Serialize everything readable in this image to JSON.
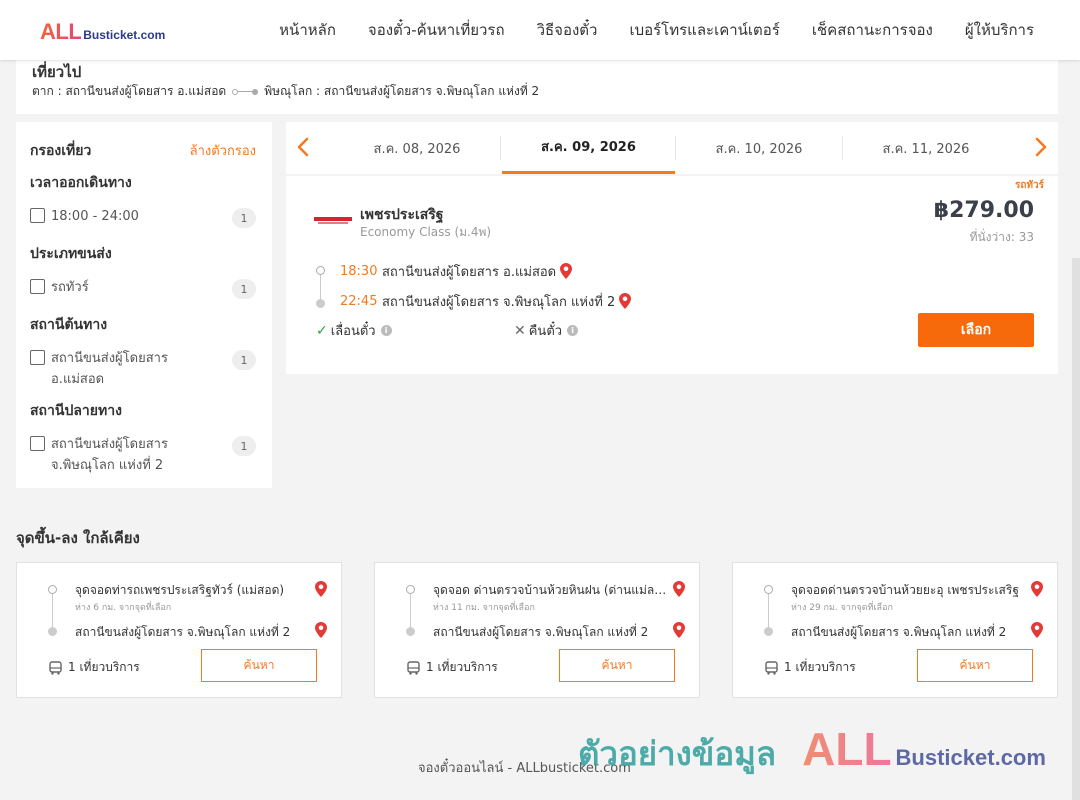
{
  "logo": {
    "all": "ALL",
    "rest": "Busticket.com"
  },
  "nav": [
    "หน้าหลัก",
    "จองตั๋ว-ค้นหาเที่ยวรถ",
    "วิธีจองตั๋ว",
    "เบอร์โทรและเคาน์เตอร์",
    "เช็คสถานะการจอง",
    "ผู้ให้บริการ"
  ],
  "trip": {
    "title": "เที่ยวไป",
    "from": "ตาก : สถานีขนส่งผู้โดยสาร อ.แม่สอด",
    "to": "พิษณุโลก : สถานีขนส่งผู้โดยสาร จ.พิษณุโลก แห่งที่ 2"
  },
  "filters": {
    "title": "กรองเที่ยว",
    "clear": "ล้างตัวกรอง",
    "sections": [
      {
        "title": "เวลาออกเดินทาง",
        "options": [
          {
            "label": "18:00 - 24:00",
            "count": "1"
          }
        ]
      },
      {
        "title": "ประเภทขนส่ง",
        "options": [
          {
            "label": "รถทัวร์",
            "count": "1"
          }
        ]
      },
      {
        "title": "สถานีต้นทาง",
        "options": [
          {
            "label": "สถานีขนส่งผู้โดยสาร อ.แม่สอด",
            "count": "1"
          }
        ]
      },
      {
        "title": "สถานีปลายทาง",
        "options": [
          {
            "label": "สถานีขนส่งผู้โดยสาร จ.พิษณุโลก แห่งที่ 2",
            "count": "1"
          }
        ]
      }
    ]
  },
  "dates": {
    "tabs": [
      "ส.ค. 08, 2026",
      "ส.ค. 09, 2026",
      "ส.ค. 10, 2026",
      "ส.ค. 11, 2026"
    ],
    "active": 1
  },
  "result": {
    "type_tag": "รถทัวร์",
    "operator": "เพชรประเสริฐ",
    "class": "Economy Class (ม.4พ)",
    "price": "฿279.00",
    "seats": "ที่นั่งว่าง: 33",
    "dep_time": "18:30",
    "dep_place": "สถานีขนส่งผู้โดยสาร อ.แม่สอด",
    "arr_time": "22:45",
    "arr_place": "สถานีขนส่งผู้โดยสาร จ.พิษณุโลก แห่งที่ 2",
    "reschedule": "เลื่อนตั๋ว",
    "refund": "คืนตั๋ว",
    "select": "เลือก"
  },
  "nearby": {
    "title": "จุดขึ้น-ลง ใกล้เคียง",
    "cards": [
      {
        "from": "จุดจอดท่ารถเพชรประเสริฐทัวร์ (แม่สอด)",
        "dist": "ห่าง 6 กม. จากจุดที่เลือก",
        "to": "สถานีขนส่งผู้โดยสาร จ.พิษณุโลก แห่งที่ 2",
        "trips": "1 เที่ยวบริการ",
        "btn": "ค้นหา"
      },
      {
        "from": "จุดจอด ด่านตรวจบ้านห้วยหินฝน (ด่านแม่ละเมา)",
        "dist": "ห่าง 11 กม. จากจุดที่เลือก",
        "to": "สถานีขนส่งผู้โดยสาร จ.พิษณุโลก แห่งที่ 2",
        "trips": "1 เที่ยวบริการ",
        "btn": "ค้นหา"
      },
      {
        "from": "จุดจอดด่านตรวจบ้านห้วยยะอุ เพชรประเสริฐ",
        "dist": "ห่าง 29 กม. จากจุดที่เลือก",
        "to": "สถานีขนส่งผู้โดยสาร จ.พิษณุโลก แห่งที่ 2",
        "trips": "1 เที่ยวบริการ",
        "btn": "ค้นหา"
      }
    ]
  },
  "footer": "จองตั๋วออนไลน์ - ALLbusticket.com",
  "watermark": {
    "thai": "ตัวอย่างข้อมูล",
    "all": "ALL",
    "rest": "Busticket.com"
  },
  "colors": {
    "accent": "#f47a20",
    "button": "#f76a0c",
    "brand_blue": "#2d3a8c",
    "teal": "#3aa3a0"
  }
}
